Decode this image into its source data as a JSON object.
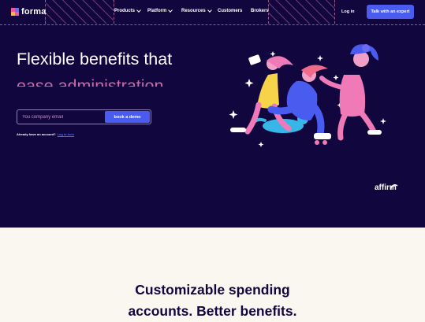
{
  "brand": {
    "name": "forma",
    "logo_colors": [
      "#f0569e",
      "#6c6cf2",
      "#f7b84b",
      "#f0569e"
    ]
  },
  "nav": {
    "items": [
      "Products",
      "Platform",
      "Resources",
      "Customers",
      "Brokers"
    ],
    "login": "Log in",
    "cta": "Talk with an expert"
  },
  "hero": {
    "title_line1": "Flexible benefits that",
    "title_line2": "ease administration",
    "email_placeholder": "You company email",
    "demo_button": "book a demo",
    "account_text": "Already have an account?",
    "account_link": "Log in here"
  },
  "partner": {
    "name": "affirm"
  },
  "section": {
    "title_line1": "Customizable spending",
    "title_line2": "accounts. Better benefits."
  },
  "colors": {
    "hero_bg": "#12063e",
    "accent": "#4a5bf0",
    "pink": "#f07ab8",
    "page_bg": "#faf7f1"
  },
  "icons": [
    "chevron-down-icon",
    "affirm-arc-icon",
    "sparkle-icon"
  ]
}
